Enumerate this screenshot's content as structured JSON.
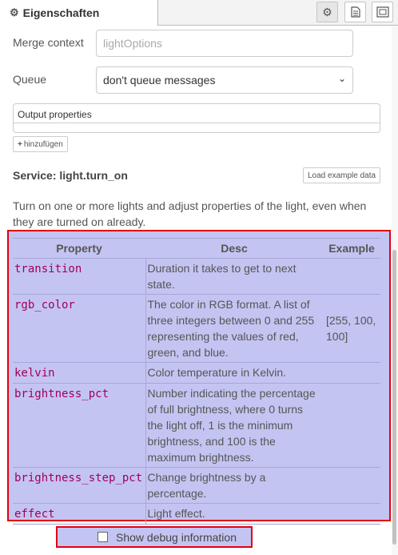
{
  "header": {
    "tab_title": "Eigenschaften",
    "buttons": [
      "gear-icon",
      "document-icon",
      "frame-icon"
    ]
  },
  "form": {
    "merge_context_label": "Merge context",
    "merge_context_placeholder": "lightOptions",
    "queue_label": "Queue",
    "queue_value": "don't queue messages",
    "output_properties_label": "Output properties",
    "add_button_label": "hinzufügen"
  },
  "service": {
    "title": "Service: light.turn_on",
    "load_example_label": "Load example data",
    "description": "Turn on one or more lights and adjust properties of the light, even when they are turned on already."
  },
  "table": {
    "headers": [
      "Property",
      "Desc",
      "Example"
    ],
    "rows": [
      {
        "name": "transition",
        "desc": "Duration it takes to get to next state.",
        "example": ""
      },
      {
        "name": "rgb_color",
        "desc": "The color in RGB format. A list of three integers between 0 and 255 representing the values of red, green, and blue.",
        "example": "[255, 100, 100]"
      },
      {
        "name": "kelvin",
        "desc": "Color temperature in Kelvin.",
        "example": ""
      },
      {
        "name": "brightness_pct",
        "desc": "Number indicating the percentage of full brightness, where 0 turns the light off, 1 is the minimum brightness, and 100 is the maximum brightness.",
        "example": ""
      },
      {
        "name": "brightness_step_pct",
        "desc": "Change brightness by a percentage.",
        "example": ""
      },
      {
        "name": "effect",
        "desc": "Light effect.",
        "example": ""
      }
    ]
  },
  "debug": {
    "label": "Show debug information",
    "checked": false
  }
}
